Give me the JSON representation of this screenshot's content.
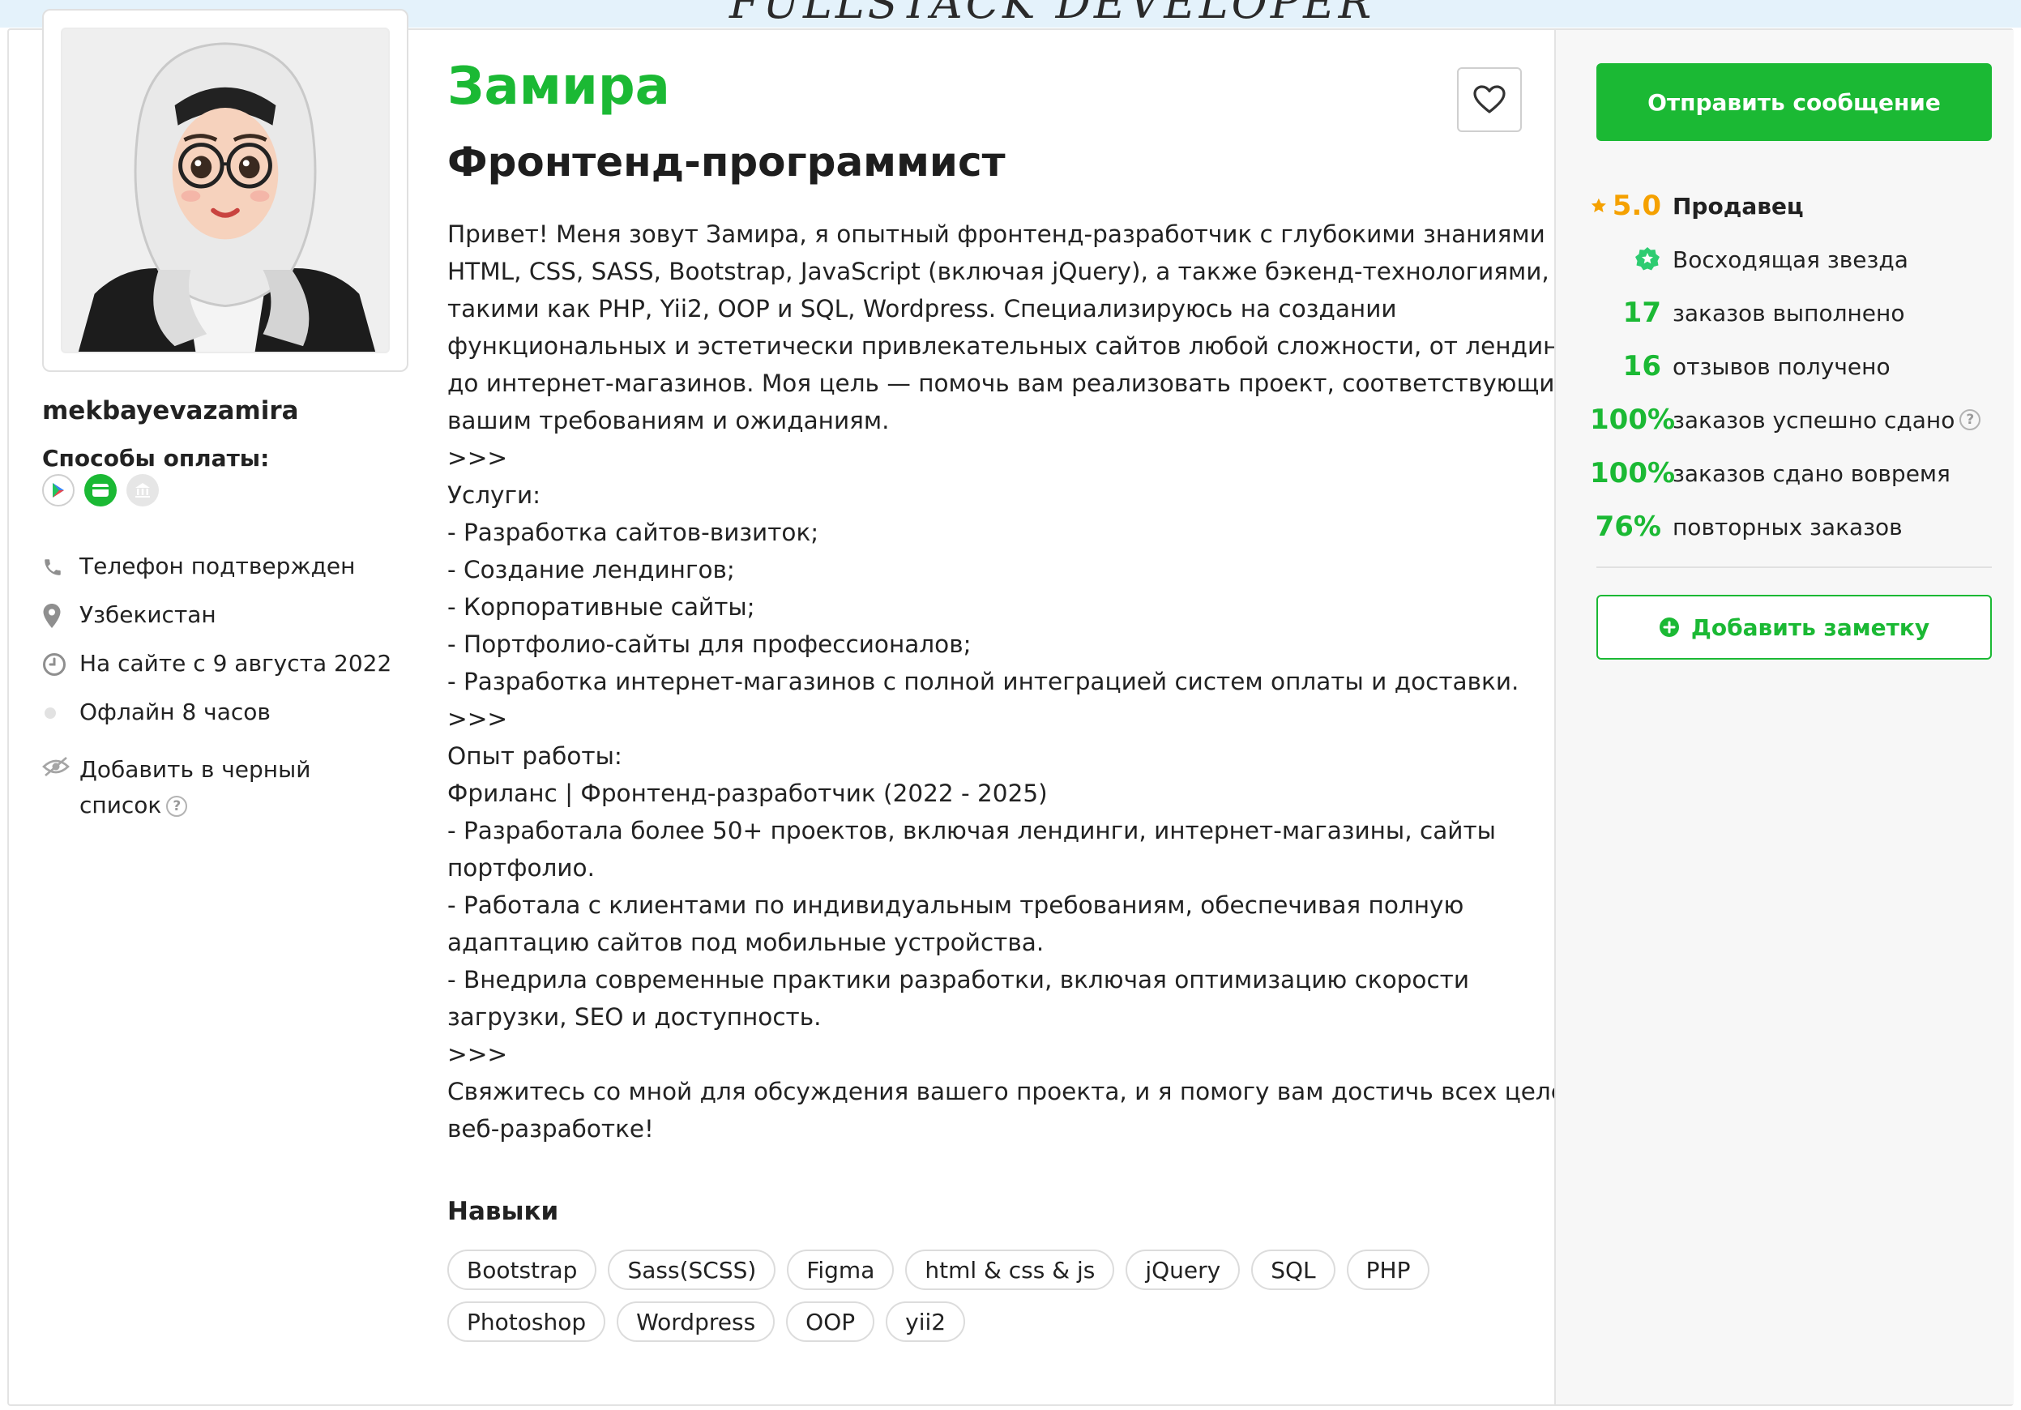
{
  "banner": {
    "text": "FULLSTACK DEVELOPER"
  },
  "profile": {
    "username": "mekbayevazamira",
    "name": "Замира",
    "role": "Фронтенд-программист",
    "payment_label": "Способы оплаты:",
    "payment_icons": [
      "play-market-icon",
      "card-icon",
      "bank-icon"
    ],
    "info": {
      "phone": "Телефон подтвержден",
      "location": "Узбекистан",
      "since": "На сайте с 9 августа 2022",
      "status": "Офлайн 8 часов",
      "blacklist_line1": "Добавить в черный",
      "blacklist_line2": "список"
    },
    "bio_lines": [
      "Привет! Меня зовут Замира, я опытный фронтенд-разработчик с глубокими знаниями в",
      "HTML, CSS, SASS, Bootstrap, JavaScript (включая jQuery), а также бэкенд-технологиями,",
      "такими как PHP, Yii2, OOP и SQL, Wordpress. Специализируюсь на создании",
      "функциональных и эстетически привлекательных сайтов любой сложности, от лендингов",
      "до интернет-магазинов. Моя цель — помочь вам реализовать проект, соответствующий",
      "вашим требованиям и ожиданиям.",
      ">>>",
      "Услуги:",
      "- Разработка сайтов-визиток;",
      "- Создание лендингов;",
      "- Корпоративные сайты;",
      "- Портфолио-сайты для профессионалов;",
      "- Разработка интернет-магазинов с полной интеграцией систем оплаты и доставки.",
      ">>>",
      "Опыт работы:",
      "Фриланс | Фронтенд-разработчик (2022 - 2025)",
      "- Разработала более 50+ проектов, включая лендинги, интернет-магазины, сайты",
      "портфолио.",
      "- Работала с клиентами по индивидуальным требованиям, обеспечивая полную",
      "адаптацию сайтов под мобильные устройства.",
      "- Внедрила современные практики разработки, включая оптимизацию скорости",
      "загрузки, SEO и доступность.",
      ">>>",
      "Свяжитесь со мной для обсуждения вашего проекта, и я помогу вам достичь всех целей в",
      "веб-разработке!"
    ],
    "skills_title": "Навыки",
    "skills": [
      "Bootstrap",
      "Sass(SCSS)",
      "Figma",
      "html & css & js",
      "jQuery",
      "SQL",
      "PHP",
      "Photoshop",
      "Wordpress",
      "OOP",
      "yii2"
    ]
  },
  "panel": {
    "send_message": "Отправить сообщение",
    "rating": "5.0",
    "rating_label": "Продавец",
    "rising_star": "Восходящая звезда",
    "orders_done_num": "17",
    "orders_done_label": "заказов выполнено",
    "reviews_num": "16",
    "reviews_label": "отзывов получено",
    "success_num": "100%",
    "success_label": "заказов успешно сдано",
    "ontime_num": "100%",
    "ontime_label": "заказов сдано вовремя",
    "repeat_num": "76%",
    "repeat_label": "повторных заказов",
    "add_note": "Добавить заметку"
  },
  "colors": {
    "accent_green": "#1bb934",
    "rating_orange": "#f5a100",
    "panel_bg": "#f7f7f7"
  }
}
